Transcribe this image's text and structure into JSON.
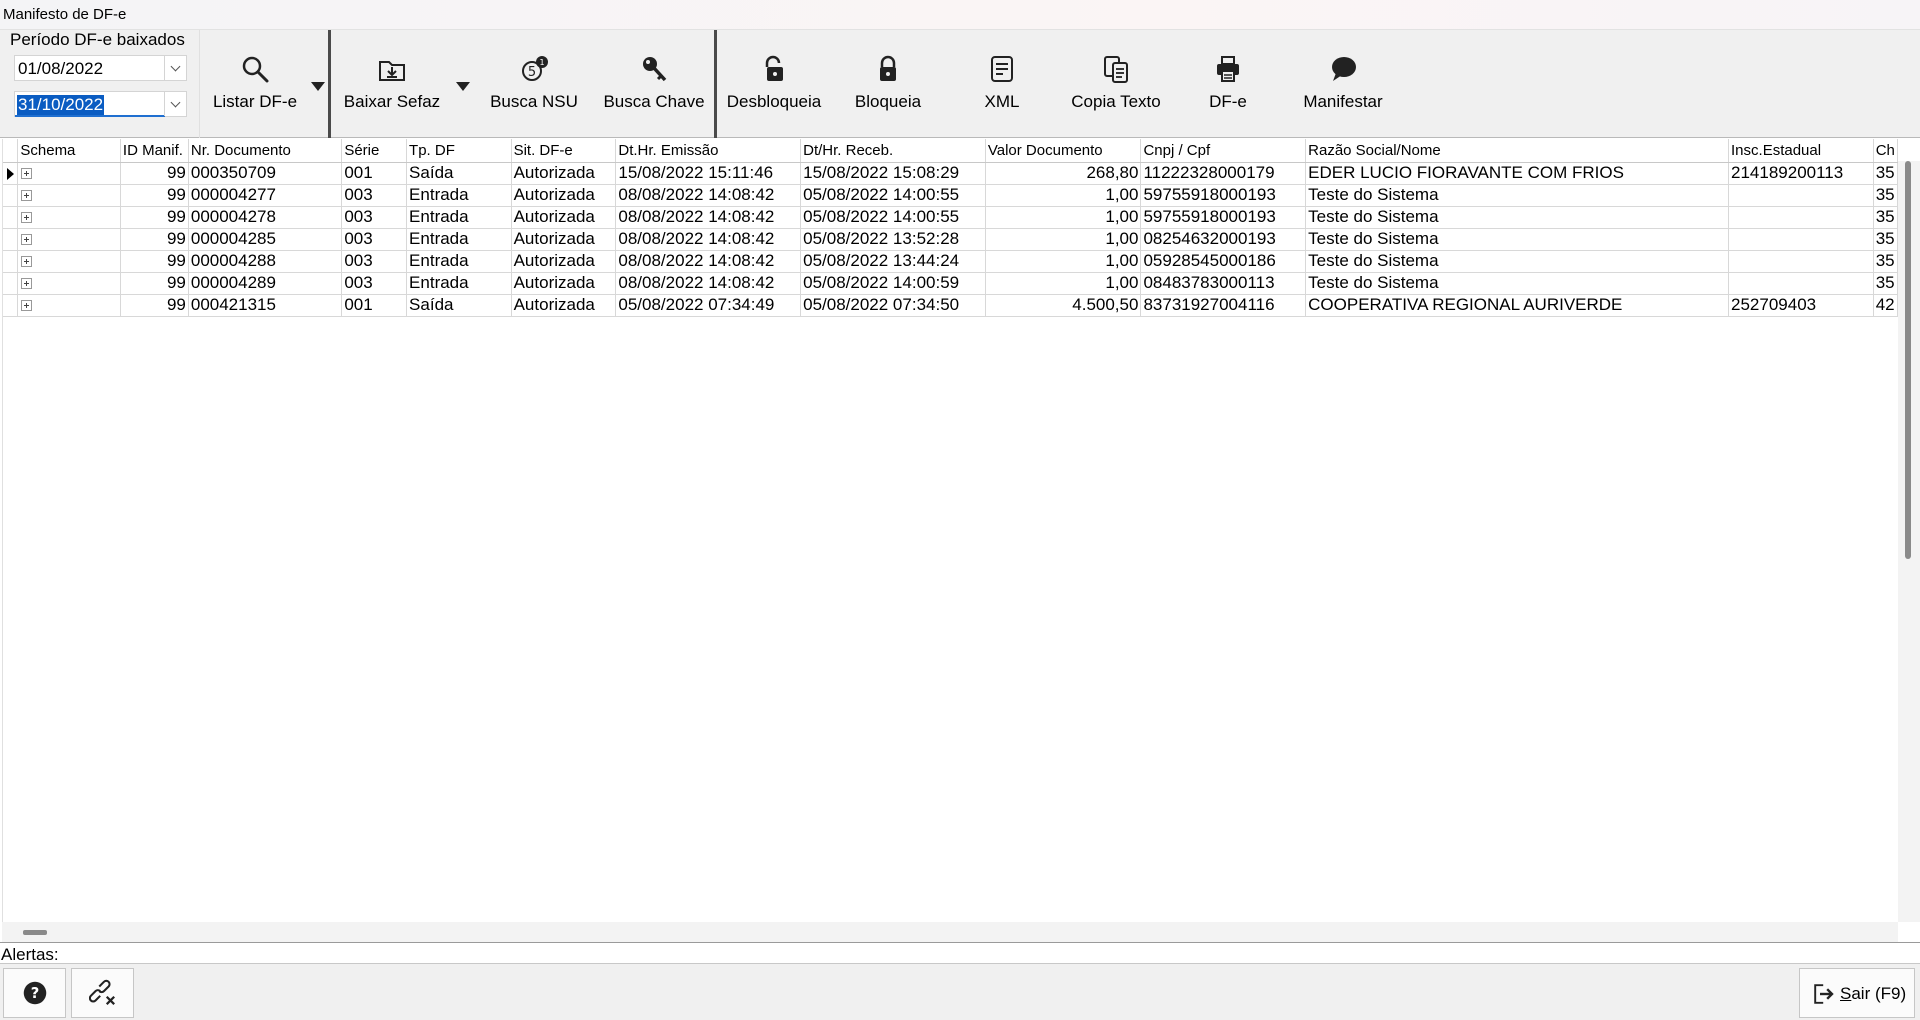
{
  "window": {
    "title": "Manifesto de DF-e"
  },
  "period": {
    "label": "Período DF-e baixados",
    "start_date": "01/08/2022",
    "end_date": "31/10/2022"
  },
  "toolbar": {
    "listar": "Listar DF-e",
    "baixar_sefaz": "Baixar Sefaz",
    "busca_nsu": "Busca NSU",
    "busca_chave": "Busca Chave",
    "desbloqueia": "Desbloqueia",
    "bloqueia": "Bloqueia",
    "xml": "XML",
    "copia_texto": "Copia Texto",
    "dfe": "DF-e",
    "manifestar": "Manifestar"
  },
  "grid": {
    "columns": [
      "Schema",
      "ID Manif.",
      "Nr. Documento",
      "Série",
      "Tp. DF",
      "Sit. DF-e",
      "Dt.Hr. Emissão",
      "Dt/Hr. Receb.",
      "Valor Documento",
      "Cnpj / Cpf",
      "Razão Social/Nome",
      "Insc.Estadual",
      "Ch"
    ],
    "rows": [
      {
        "id": "99",
        "nr": "000350709",
        "serie": "001",
        "tp": "Saída",
        "sit": "Autorizada",
        "emissao": "15/08/2022 15:11:46",
        "receb": "15/08/2022 15:08:29",
        "valor": "268,80",
        "cnpj": "11222328000179",
        "razao": "EDER LUCIO FIORAVANTE COM FRIOS",
        "ie": "214189200113",
        "ch": "35"
      },
      {
        "id": "99",
        "nr": "000004277",
        "serie": "003",
        "tp": "Entrada",
        "sit": "Autorizada",
        "emissao": "08/08/2022 14:08:42",
        "receb": "05/08/2022 14:00:55",
        "valor": "1,00",
        "cnpj": "59755918000193",
        "razao": "Teste do Sistema",
        "ie": "",
        "ch": "35"
      },
      {
        "id": "99",
        "nr": "000004278",
        "serie": "003",
        "tp": "Entrada",
        "sit": "Autorizada",
        "emissao": "08/08/2022 14:08:42",
        "receb": "05/08/2022 14:00:55",
        "valor": "1,00",
        "cnpj": "59755918000193",
        "razao": "Teste do Sistema",
        "ie": "",
        "ch": "35"
      },
      {
        "id": "99",
        "nr": "000004285",
        "serie": "003",
        "tp": "Entrada",
        "sit": "Autorizada",
        "emissao": "08/08/2022 14:08:42",
        "receb": "05/08/2022 13:52:28",
        "valor": "1,00",
        "cnpj": "08254632000193",
        "razao": "Teste do Sistema",
        "ie": "",
        "ch": "35"
      },
      {
        "id": "99",
        "nr": "000004288",
        "serie": "003",
        "tp": "Entrada",
        "sit": "Autorizada",
        "emissao": "08/08/2022 14:08:42",
        "receb": "05/08/2022 13:44:24",
        "valor": "1,00",
        "cnpj": "05928545000186",
        "razao": "Teste do Sistema",
        "ie": "",
        "ch": "35"
      },
      {
        "id": "99",
        "nr": "000004289",
        "serie": "003",
        "tp": "Entrada",
        "sit": "Autorizada",
        "emissao": "08/08/2022 14:08:42",
        "receb": "05/08/2022 14:00:59",
        "valor": "1,00",
        "cnpj": "08483783000113",
        "razao": "Teste do Sistema",
        "ie": "",
        "ch": "35"
      },
      {
        "id": "99",
        "nr": "000421315",
        "serie": "001",
        "tp": "Saída",
        "sit": "Autorizada",
        "emissao": "05/08/2022 07:34:49",
        "receb": "05/08/2022 07:34:50",
        "valor": "4.500,50",
        "cnpj": "83731927004116",
        "razao": "COOPERATIVA REGIONAL AURIVERDE",
        "ie": "252709403",
        "ch": "42"
      }
    ]
  },
  "alerts": {
    "label": "Alertas:"
  },
  "bottom": {
    "help_icon": "question-circle-icon",
    "unlink_icon": "link-broken-icon",
    "exit_prefix": "S",
    "exit_rest": "air (F9)"
  }
}
